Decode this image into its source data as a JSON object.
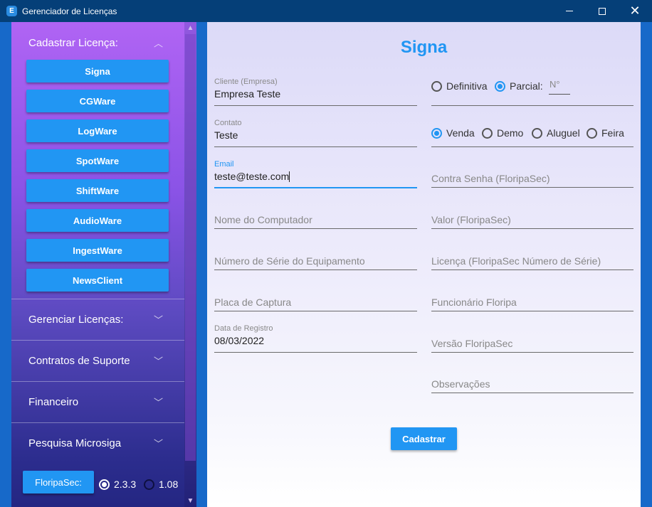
{
  "window": {
    "title": "Gerenciador de Licenças",
    "icon_letter": "E",
    "minimize_glyph": "",
    "close_glyph": "✕"
  },
  "sidebar": {
    "section1": {
      "label": "Cadastrar Licença:",
      "chevron": "︿"
    },
    "buttons": [
      "Signa",
      "CGWare",
      "LogWare",
      "SpotWare",
      "ShiftWare",
      "AudioWare",
      "IngestWare",
      "NewsClient"
    ],
    "sections": [
      {
        "label": "Gerenciar Licenças:",
        "chevron": "﹀"
      },
      {
        "label": "Contratos de Suporte",
        "chevron": "﹀"
      },
      {
        "label": "Financeiro",
        "chevron": "﹀"
      },
      {
        "label": "Pesquisa Microsiga",
        "chevron": "﹀"
      }
    ],
    "floripa_button": "FloripaSec:",
    "versions": [
      {
        "label": "2.3.3",
        "selected": true
      },
      {
        "label": "1.08",
        "selected": false
      }
    ],
    "scroll_up": "▲",
    "scroll_down": "▼"
  },
  "form": {
    "title": "Signa",
    "left": {
      "cliente": {
        "label": "Cliente (Empresa)",
        "value": "Empresa Teste"
      },
      "contato": {
        "label": "Contato",
        "value": "Teste"
      },
      "email": {
        "label": "Email",
        "value": "teste@teste.com"
      },
      "computador": {
        "placeholder": "Nome do Computador"
      },
      "serie": {
        "placeholder": "Número de Série do Equipamento"
      },
      "placa": {
        "placeholder": "Placa de Captura"
      },
      "data_registro": {
        "label": "Data de Registro",
        "value": "08/03/2022"
      }
    },
    "right": {
      "tipo_licenca": {
        "options": [
          {
            "label": "Definitiva",
            "selected": false
          },
          {
            "label": "Parcial:",
            "selected": true
          }
        ],
        "numero_placeholder": "N°"
      },
      "tipo_venda": {
        "options": [
          {
            "label": "Venda",
            "selected": true
          },
          {
            "label": "Demo",
            "selected": false
          },
          {
            "label": "Aluguel",
            "selected": false
          },
          {
            "label": "Feira",
            "selected": false
          }
        ]
      },
      "contra_senha": {
        "placeholder": "Contra Senha (FloripaSec)"
      },
      "valor": {
        "placeholder": "Valor (FloripaSec)"
      },
      "licenca": {
        "placeholder": "Licença (FloripaSec Número de Série)"
      },
      "funcionario": {
        "placeholder": "Funcionário Floripa"
      },
      "versao": {
        "placeholder": "Versão FloripaSec"
      },
      "observacoes": {
        "placeholder": "Observações"
      }
    },
    "submit": "Cadastrar"
  },
  "colors": {
    "accent": "#2196f3",
    "titlebar": "#053f78",
    "frame": "#1769c9"
  }
}
